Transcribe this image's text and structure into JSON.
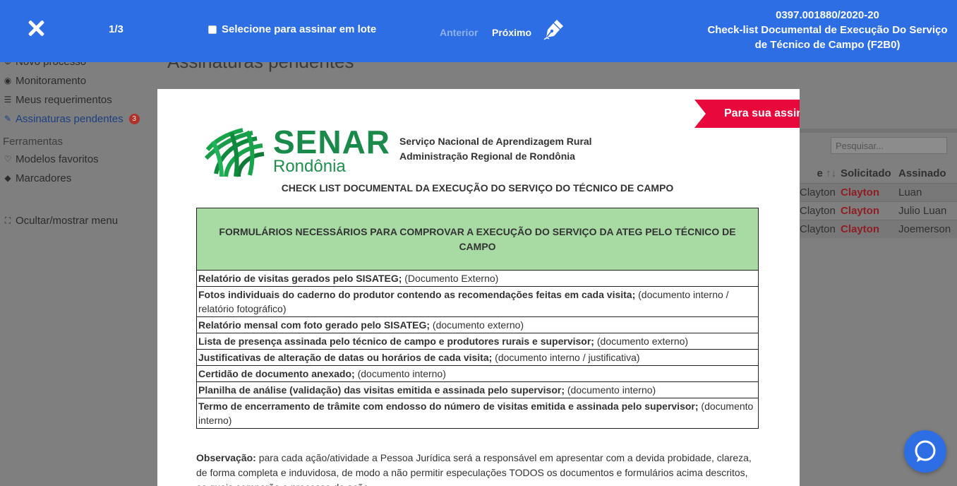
{
  "topbar": {
    "counter": "1/3",
    "batch_label": "Selecione para assinar em lote",
    "prev_label": "Anterior",
    "next_label": "Próximo",
    "doc_id": "0397.001880/2020-20",
    "doc_title": "Check-list Documental de Execução Do Serviço de Técnico de Campo (F2B0)",
    "accent": "#2d6ee5",
    "icons": {
      "close": "close-icon",
      "sign": "signature-pen-icon"
    }
  },
  "background": {
    "page_title": "Assinaturas pendentes",
    "sidebar": {
      "items": [
        {
          "label": "Novo processo",
          "icon": "plus-circle-icon"
        },
        {
          "label": "Monitoramento",
          "icon": "eye-icon"
        },
        {
          "label": "Meus requerimentos",
          "icon": "list-icon"
        },
        {
          "label": "Assinaturas pendentes",
          "icon": "pen-icon",
          "badge": "3"
        }
      ],
      "tools_heading": "Ferramentas",
      "tools": [
        {
          "label": "Modelos favoritos",
          "icon": "heart-icon"
        },
        {
          "label": "Marcadores",
          "icon": "tags-icon"
        }
      ],
      "toggle_menu": "Ocultar/mostrar menu"
    },
    "search_placeholder": "Pesquisar...",
    "table": {
      "headers": [
        "e",
        "Solicitado",
        "Assinado"
      ],
      "rows": [
        {
          "c1": "Clayton",
          "c2": "Clayton",
          "c3": "Luan"
        },
        {
          "c1": "Clayton",
          "c2": "Clayton",
          "c3": "Julio Luan"
        },
        {
          "c1": "Clayton",
          "c2": "Clayton",
          "c3": "Joemerson"
        }
      ]
    }
  },
  "document": {
    "ribbon": "Para sua assinatura",
    "logo_main": "SENAR",
    "logo_sub": "Rondônia",
    "org_line1": "Serviço Nacional de Aprendizagem Rural",
    "org_line2": "Administração Regional de Rondônia",
    "title": "CHECK LIST DOCUMENTAL DA EXECUÇÃO DO SERVIÇO DO TÉCNICO DE CAMPO",
    "table_header": "FORMULÁRIOS NECESSÁRIOS PARA COMPROVAR A EXECUÇÃO DO SERVIÇO DA ATEG PELO TÉCNICO DE CAMPO",
    "items": [
      {
        "bold": "Relatório de visitas gerados pelo SISATEG;",
        "normal": " (Documento Externo)"
      },
      {
        "bold": "Fotos individuais do caderno do produtor contendo as recomendações feitas em cada visita;",
        "normal": " (documento interno / relatório fotográfico)"
      },
      {
        "bold": "Relatório mensal com foto gerado pelo SISATEG;",
        "normal": " (documento externo)"
      },
      {
        "bold": "Lista de presença assinada pelo técnico de campo e produtores rurais e supervisor;",
        "normal": " (documento externo)"
      },
      {
        "bold": "Justificativas de alteração de datas ou horários de cada visita;",
        "normal": " (documento interno / justificativa)"
      },
      {
        "bold": "Certidão de documento anexado;",
        "normal": " (documento interno)"
      },
      {
        "bold": "Planilha de análise (validação) das visitas emitida e assinada pelo supervisor;",
        "normal": " (documento interno)"
      },
      {
        "bold": "Termo de encerramento de trâmite com endosso do número de visitas emitida e assinada pelo supervisor;",
        "normal": " (documento interno)"
      }
    ],
    "obs_label": "Observação:",
    "obs_text": " para cada ação/atividade a Pessoa Jurídica será a responsável em apresentar com a devida probidade, clareza, de forma completa e induvidosa, de modo a não permitir especulações TODOS os documentos e formulários acima descritos, os quais comporão o processo de ação."
  }
}
